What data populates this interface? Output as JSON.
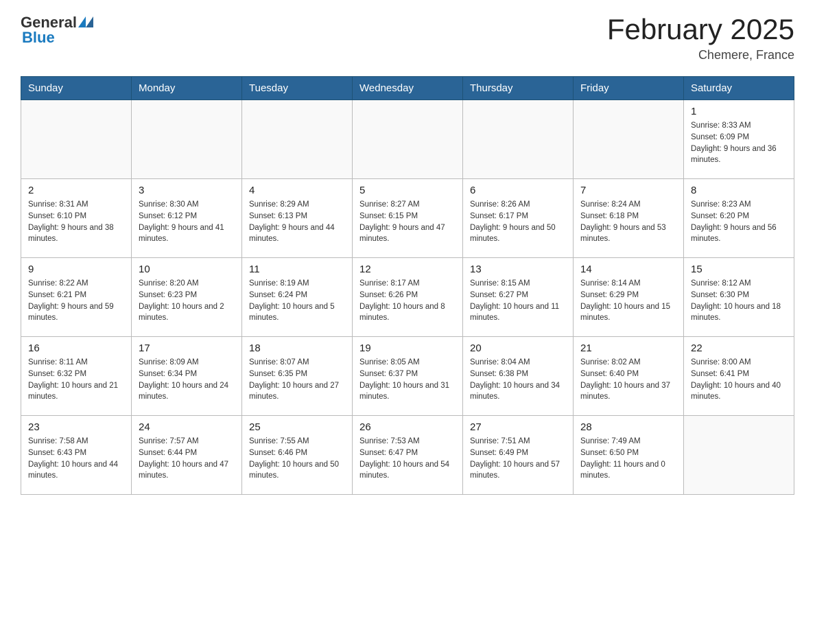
{
  "header": {
    "logo_general": "General",
    "logo_blue": "Blue",
    "title": "February 2025",
    "location": "Chemere, France"
  },
  "days_of_week": [
    "Sunday",
    "Monday",
    "Tuesday",
    "Wednesday",
    "Thursday",
    "Friday",
    "Saturday"
  ],
  "weeks": [
    {
      "days": [
        {
          "number": "",
          "info": ""
        },
        {
          "number": "",
          "info": ""
        },
        {
          "number": "",
          "info": ""
        },
        {
          "number": "",
          "info": ""
        },
        {
          "number": "",
          "info": ""
        },
        {
          "number": "",
          "info": ""
        },
        {
          "number": "1",
          "info": "Sunrise: 8:33 AM\nSunset: 6:09 PM\nDaylight: 9 hours and 36 minutes."
        }
      ]
    },
    {
      "days": [
        {
          "number": "2",
          "info": "Sunrise: 8:31 AM\nSunset: 6:10 PM\nDaylight: 9 hours and 38 minutes."
        },
        {
          "number": "3",
          "info": "Sunrise: 8:30 AM\nSunset: 6:12 PM\nDaylight: 9 hours and 41 minutes."
        },
        {
          "number": "4",
          "info": "Sunrise: 8:29 AM\nSunset: 6:13 PM\nDaylight: 9 hours and 44 minutes."
        },
        {
          "number": "5",
          "info": "Sunrise: 8:27 AM\nSunset: 6:15 PM\nDaylight: 9 hours and 47 minutes."
        },
        {
          "number": "6",
          "info": "Sunrise: 8:26 AM\nSunset: 6:17 PM\nDaylight: 9 hours and 50 minutes."
        },
        {
          "number": "7",
          "info": "Sunrise: 8:24 AM\nSunset: 6:18 PM\nDaylight: 9 hours and 53 minutes."
        },
        {
          "number": "8",
          "info": "Sunrise: 8:23 AM\nSunset: 6:20 PM\nDaylight: 9 hours and 56 minutes."
        }
      ]
    },
    {
      "days": [
        {
          "number": "9",
          "info": "Sunrise: 8:22 AM\nSunset: 6:21 PM\nDaylight: 9 hours and 59 minutes."
        },
        {
          "number": "10",
          "info": "Sunrise: 8:20 AM\nSunset: 6:23 PM\nDaylight: 10 hours and 2 minutes."
        },
        {
          "number": "11",
          "info": "Sunrise: 8:19 AM\nSunset: 6:24 PM\nDaylight: 10 hours and 5 minutes."
        },
        {
          "number": "12",
          "info": "Sunrise: 8:17 AM\nSunset: 6:26 PM\nDaylight: 10 hours and 8 minutes."
        },
        {
          "number": "13",
          "info": "Sunrise: 8:15 AM\nSunset: 6:27 PM\nDaylight: 10 hours and 11 minutes."
        },
        {
          "number": "14",
          "info": "Sunrise: 8:14 AM\nSunset: 6:29 PM\nDaylight: 10 hours and 15 minutes."
        },
        {
          "number": "15",
          "info": "Sunrise: 8:12 AM\nSunset: 6:30 PM\nDaylight: 10 hours and 18 minutes."
        }
      ]
    },
    {
      "days": [
        {
          "number": "16",
          "info": "Sunrise: 8:11 AM\nSunset: 6:32 PM\nDaylight: 10 hours and 21 minutes."
        },
        {
          "number": "17",
          "info": "Sunrise: 8:09 AM\nSunset: 6:34 PM\nDaylight: 10 hours and 24 minutes."
        },
        {
          "number": "18",
          "info": "Sunrise: 8:07 AM\nSunset: 6:35 PM\nDaylight: 10 hours and 27 minutes."
        },
        {
          "number": "19",
          "info": "Sunrise: 8:05 AM\nSunset: 6:37 PM\nDaylight: 10 hours and 31 minutes."
        },
        {
          "number": "20",
          "info": "Sunrise: 8:04 AM\nSunset: 6:38 PM\nDaylight: 10 hours and 34 minutes."
        },
        {
          "number": "21",
          "info": "Sunrise: 8:02 AM\nSunset: 6:40 PM\nDaylight: 10 hours and 37 minutes."
        },
        {
          "number": "22",
          "info": "Sunrise: 8:00 AM\nSunset: 6:41 PM\nDaylight: 10 hours and 40 minutes."
        }
      ]
    },
    {
      "days": [
        {
          "number": "23",
          "info": "Sunrise: 7:58 AM\nSunset: 6:43 PM\nDaylight: 10 hours and 44 minutes."
        },
        {
          "number": "24",
          "info": "Sunrise: 7:57 AM\nSunset: 6:44 PM\nDaylight: 10 hours and 47 minutes."
        },
        {
          "number": "25",
          "info": "Sunrise: 7:55 AM\nSunset: 6:46 PM\nDaylight: 10 hours and 50 minutes."
        },
        {
          "number": "26",
          "info": "Sunrise: 7:53 AM\nSunset: 6:47 PM\nDaylight: 10 hours and 54 minutes."
        },
        {
          "number": "27",
          "info": "Sunrise: 7:51 AM\nSunset: 6:49 PM\nDaylight: 10 hours and 57 minutes."
        },
        {
          "number": "28",
          "info": "Sunrise: 7:49 AM\nSunset: 6:50 PM\nDaylight: 11 hours and 0 minutes."
        },
        {
          "number": "",
          "info": ""
        }
      ]
    }
  ]
}
